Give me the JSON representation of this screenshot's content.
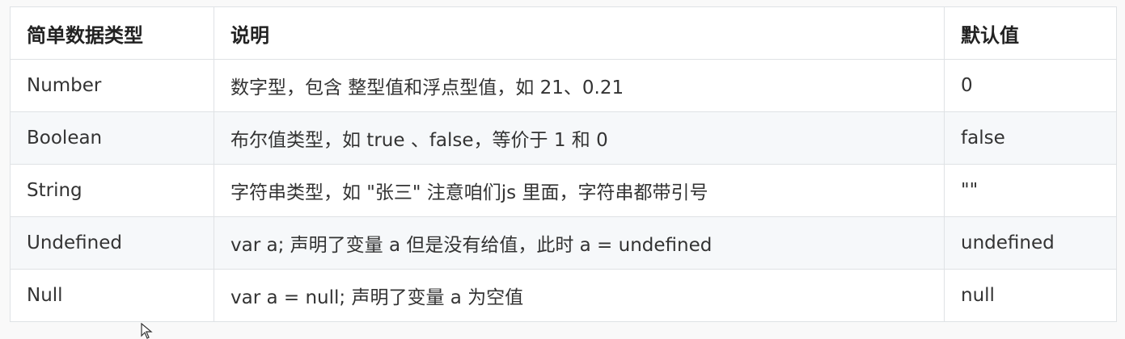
{
  "table": {
    "headers": [
      "简单数据类型",
      "说明",
      "默认值"
    ],
    "rows": [
      [
        "Number",
        "数字型，包含 整型值和浮点型值，如 21、0.21",
        "0"
      ],
      [
        "Boolean",
        "布尔值类型，如 true 、false，等价于 1 和 0",
        "false"
      ],
      [
        "String",
        "字符串类型，如 \"张三\"  注意咱们js 里面，字符串都带引号",
        "\"\""
      ],
      [
        "Undefined",
        "var a;  声明了变量 a 但是没有给值，此时 a = undefined",
        "undefined"
      ],
      [
        "Null",
        "var a = null;  声明了变量 a  为空值",
        "null"
      ]
    ]
  },
  "cursor": {
    "icon": "mouse-pointer-icon"
  }
}
